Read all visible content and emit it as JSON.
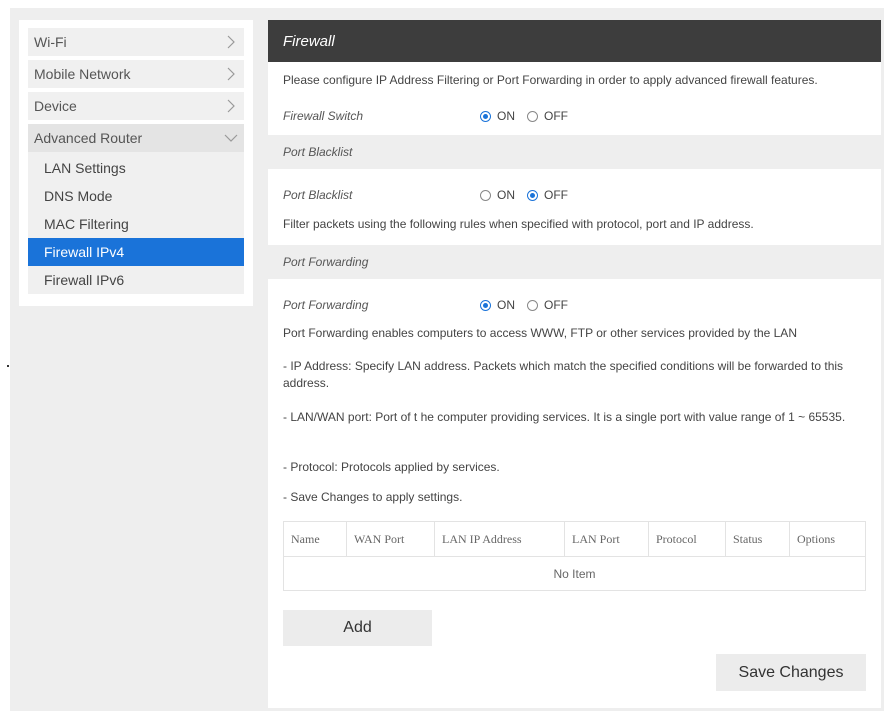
{
  "sidebar": {
    "items": [
      {
        "label": "Wi-Fi"
      },
      {
        "label": "Mobile Network"
      },
      {
        "label": "Device"
      },
      {
        "label": "Advanced Router"
      }
    ],
    "subitems": [
      {
        "label": "LAN Settings"
      },
      {
        "label": "DNS Mode"
      },
      {
        "label": "MAC Filtering"
      },
      {
        "label": "Firewall IPv4"
      },
      {
        "label": "Firewall IPv6"
      }
    ]
  },
  "main": {
    "title": "Firewall",
    "intro": "Please configure IP Address Filtering or Port Forwarding in order to apply advanced firewall features.",
    "firewall_switch": {
      "label": "Firewall Switch",
      "on": "ON",
      "off": "OFF",
      "selected": "ON"
    },
    "section_blacklist": "Port Blacklist",
    "port_blacklist": {
      "label": "Port Blacklist",
      "on": "ON",
      "off": "OFF",
      "selected": "OFF"
    },
    "blacklist_desc": "Filter packets using the following rules when specified with protocol, port and IP address.",
    "section_forwarding": "Port Forwarding",
    "port_forwarding": {
      "label": "Port Forwarding",
      "on": "ON",
      "off": "OFF",
      "selected": "ON"
    },
    "forwarding_desc": "Port Forwarding enables computers to access WWW, FTP or other services provided by the LAN",
    "ip_address_desc": "- IP Address: Specify LAN address. Packets which match the specified conditions will be forwarded to this address.",
    "lan_wan_desc": "- LAN/WAN port: Port of t he computer providing services. It is a single port with value range of 1 ~ 65535.",
    "protocol_desc": "- Protocol: Protocols applied by services.",
    "save_desc": "- Save Changes to apply settings.",
    "table": {
      "headers": [
        "Name",
        "WAN Port",
        "LAN IP Address",
        "LAN Port",
        "Protocol",
        "Status",
        "Options"
      ],
      "empty": "No Item"
    },
    "add_label": "Add",
    "save_label": "Save Changes"
  },
  "colors": {
    "accent": "#1a73d9",
    "header": "#3d3d3d"
  },
  "icons": {
    "menu_collapsed": "chevron-right-icon",
    "menu_expanded": "chevron-down-icon"
  }
}
